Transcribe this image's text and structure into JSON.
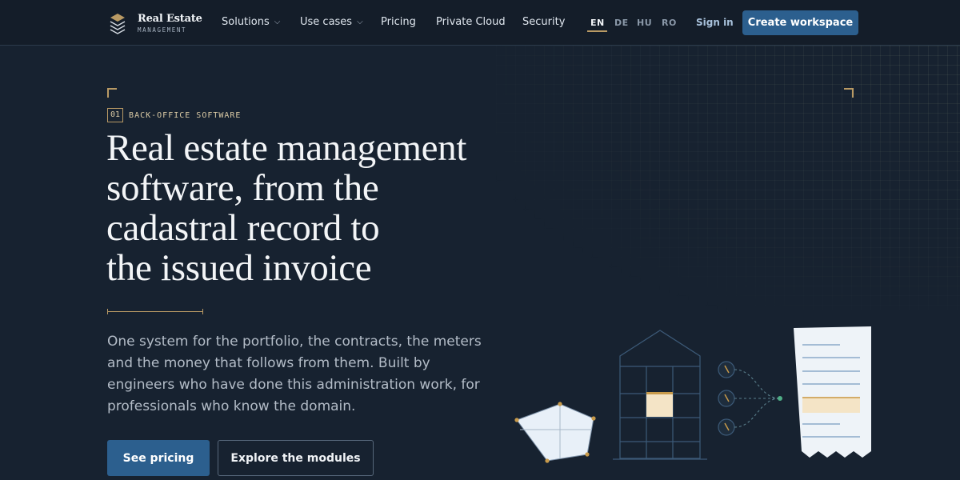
{
  "brand": {
    "title": "Real Estate",
    "subtitle": "MANAGEMENT",
    "icon": "stacked-layers-logo"
  },
  "nav": {
    "items": [
      {
        "label": "Solutions",
        "has_dropdown": true
      },
      {
        "label": "Use cases",
        "has_dropdown": true
      },
      {
        "label": "Pricing",
        "has_dropdown": false
      },
      {
        "label": "Private Cloud",
        "has_dropdown": false
      },
      {
        "label": "Security",
        "has_dropdown": false
      }
    ],
    "languages": [
      "EN",
      "DE",
      "HU",
      "RO"
    ],
    "active_language": "EN",
    "signin_label": "Sign in",
    "cta_label": "Create workspace"
  },
  "hero": {
    "eyebrow_number": "01",
    "eyebrow_text": "BACK-OFFICE SOFTWARE",
    "headline_lines": [
      "Real estate management",
      "software, from the",
      "cadastral record to",
      "the issued invoice"
    ],
    "lede": "One system for the portfolio, the contracts, the meters and the money that follows from them. Built by engineers who have done this administration work, for professionals who know the domain.",
    "primary_button": "See pricing",
    "secondary_button": "Explore the modules"
  },
  "colors": {
    "background": "#172230",
    "header_background": "#141d29",
    "accent_blue": "#2c5f8e",
    "accent_gold": "#b99a64",
    "text_primary": "#f3f5f7",
    "text_muted": "#b3bcc7"
  },
  "illustration": {
    "parts": [
      "cadastral-plot-icon",
      "building-icon",
      "meter-icon",
      "invoice-icon"
    ]
  }
}
